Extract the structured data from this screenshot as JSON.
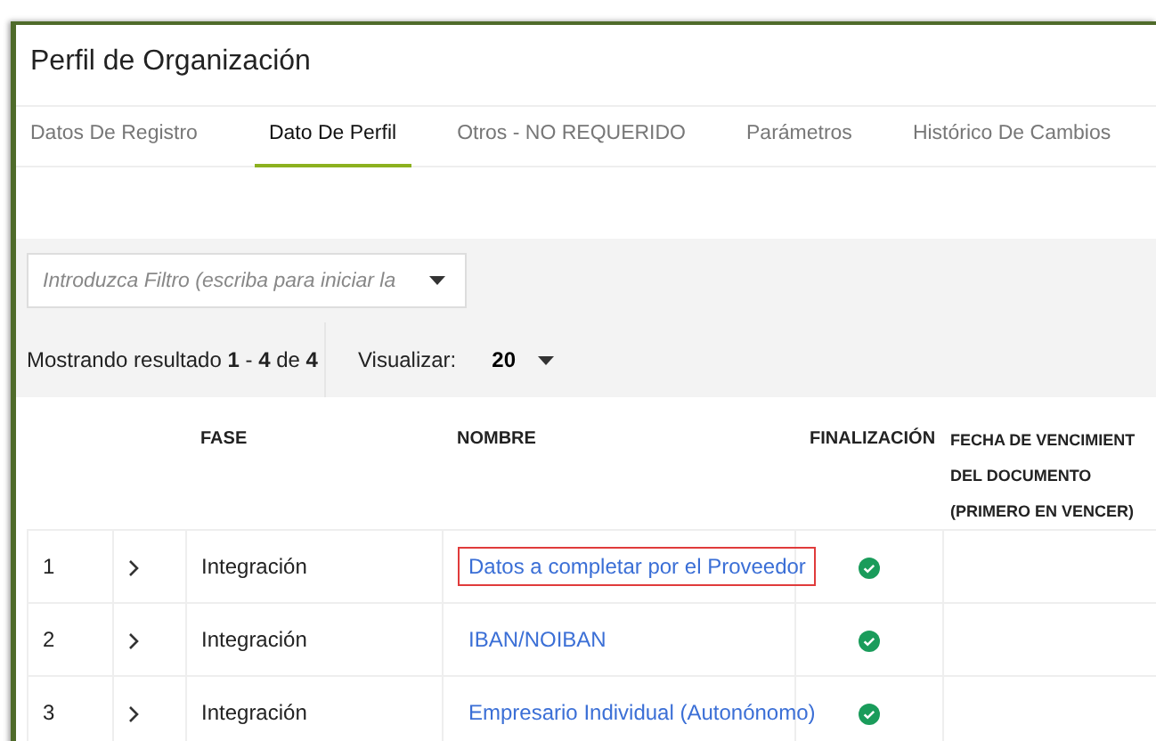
{
  "window": {
    "title": "Perfil de Organización"
  },
  "tabs": [
    {
      "label": "Datos De Registro",
      "selected": false
    },
    {
      "label": "Dato De Perfil",
      "selected": true
    },
    {
      "label": "Otros - NO REQUERIDO",
      "selected": false
    },
    {
      "label": "Parámetros",
      "selected": false
    },
    {
      "label": "Histórico De Cambios",
      "selected": false
    }
  ],
  "filter": {
    "placeholder": "Introduzca Filtro (escriba para iniciar la"
  },
  "results": {
    "text": "Mostrando resultado **1** - **4** de **4**",
    "view_label": "Visualizar:",
    "view_value": "20"
  },
  "table": {
    "columns": [
      "",
      "",
      "FASE",
      "NOMBRE",
      "FINALIZACIÓN",
      "FECHA DE VENCIMIENT\nDEL DOCUMENTO\n(PRIMERO EN VENCER)"
    ],
    "rows": [
      {
        "number": "1",
        "fase": "Integración",
        "nombre": "Datos a completar por el Proveedor",
        "highlighted": true,
        "finished": true
      },
      {
        "number": "2",
        "fase": "Integración",
        "nombre": "IBAN/NOIBAN",
        "highlighted": false,
        "finished": true
      },
      {
        "number": "3",
        "fase": "Integración",
        "nombre": "Empresario Individual (Autonónomo)",
        "highlighted": false,
        "finished": true
      }
    ]
  }
}
